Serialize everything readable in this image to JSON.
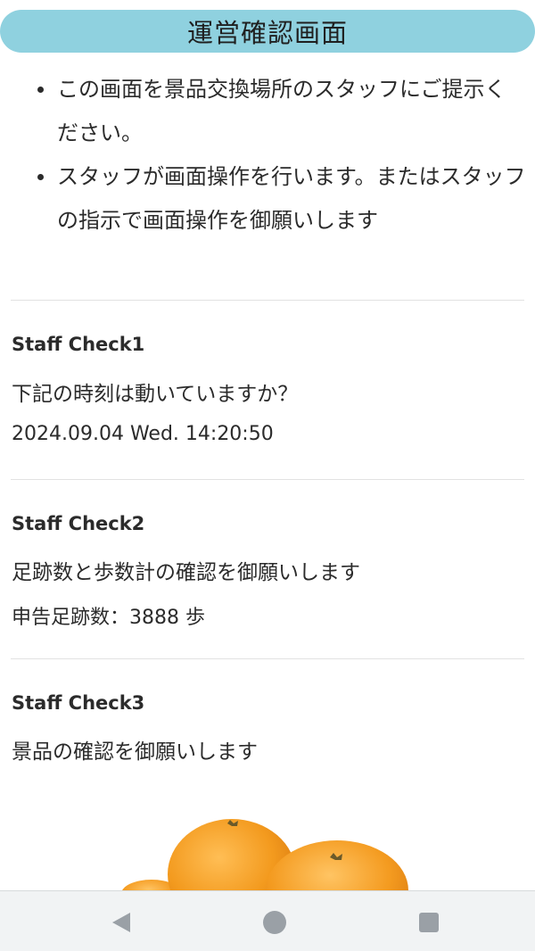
{
  "header": {
    "title": "運営確認画面"
  },
  "notices": [
    {
      "text": "この画面を景品交換場所のスタッフにご提示ください。"
    },
    {
      "text": "スタッフが画面操作を行います。またはスタッフの指示で画面操作を御願いします"
    }
  ],
  "checks": [
    {
      "title": "Staff Check1",
      "text": "下記の時刻は動いていますか？",
      "value": "2024.09.04 Wed. 14:20:50"
    },
    {
      "title": "Staff Check2",
      "text": "足跡数と歩数計の確認を御願いします",
      "value": "申告足跡数：3888 歩"
    },
    {
      "title": "Staff Check3",
      "text": "景品の確認を御願いします"
    }
  ],
  "prize": {
    "icon": "mandarin-oranges-image"
  },
  "nav": {
    "back_icon": "back-triangle-icon",
    "home_icon": "home-circle-icon",
    "recents_icon": "recents-square-icon"
  },
  "colors": {
    "header_bg": "#8fd1df",
    "orange": "#f29a1e",
    "nav_bg": "#f1f3f4",
    "nav_icon": "#9aa0a6"
  }
}
